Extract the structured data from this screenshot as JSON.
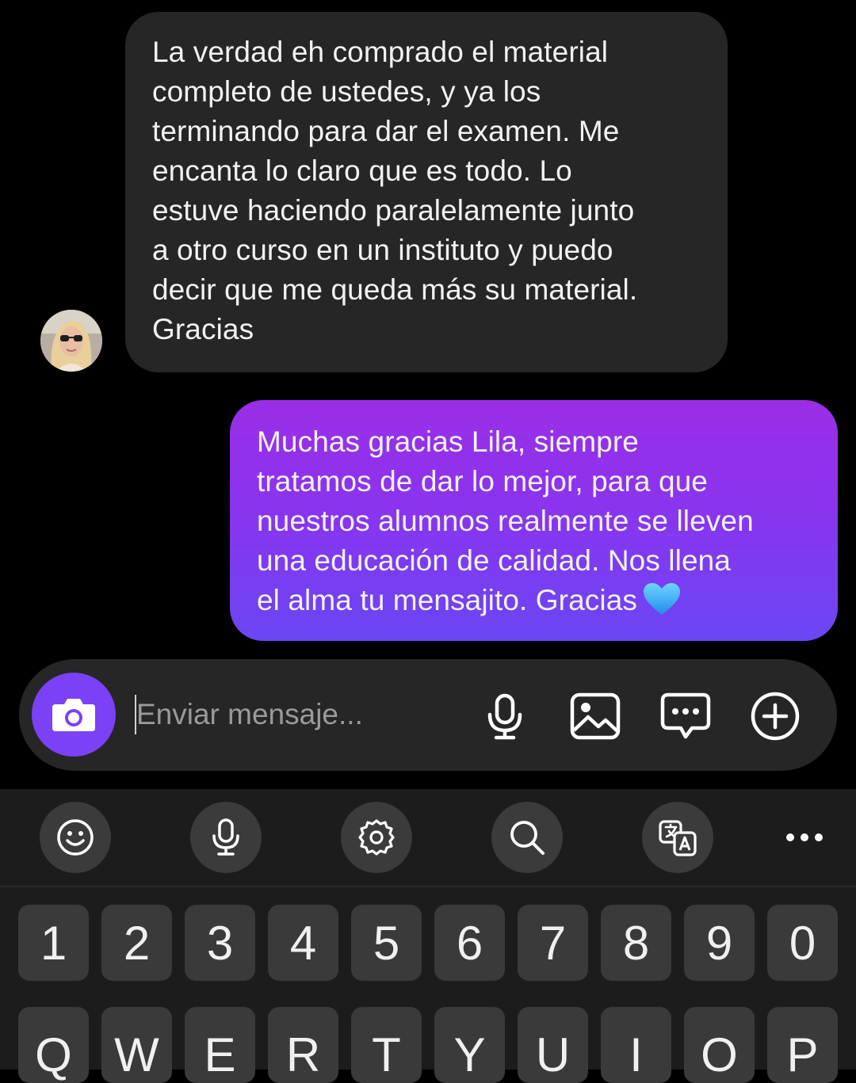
{
  "conversation": {
    "incoming": {
      "text": "La verdad eh comprado el material\ncompleto de ustedes, y ya los\nterminando para dar el examen. Me\nencanta lo claro que es todo. Lo\nestuve haciendo paralelamente junto\na otro curso en un instituto y puedo\ndecir que me queda más su material.\nGracias"
    },
    "outgoing": {
      "text": "Muchas gracias Lila, siempre\ntratamos de dar lo mejor, para que\nnuestros alumnos realmente se lleven\nuna educación de calidad. Nos llena\nel alma tu mensajito. Gracias",
      "emoji": "blue-heart-icon"
    }
  },
  "composer": {
    "placeholder": "Enviar mensaje...",
    "value": "",
    "icons": [
      "camera-icon",
      "microphone-icon",
      "image-icon",
      "sticker-chat-icon",
      "plus-circle-icon"
    ]
  },
  "keyboard": {
    "toolbar": [
      "emoji-icon",
      "voice-input-icon",
      "settings-icon",
      "search-icon",
      "translate-icon",
      "more-icon"
    ],
    "number_row": [
      "1",
      "2",
      "3",
      "4",
      "5",
      "6",
      "7",
      "8",
      "9",
      "0"
    ],
    "letter_row": [
      "Q",
      "W",
      "E",
      "R",
      "T",
      "Y",
      "U",
      "I",
      "O",
      "P"
    ]
  },
  "colors": {
    "background": "#000000",
    "incoming_bubble": "#262626",
    "outgoing_gradient_top": "#9b2ee6",
    "outgoing_gradient_bottom": "#6a46f4",
    "camera_button": "#7a41f6",
    "keyboard_bg": "#1c1c1c",
    "key_bg": "#3a3a3a"
  }
}
